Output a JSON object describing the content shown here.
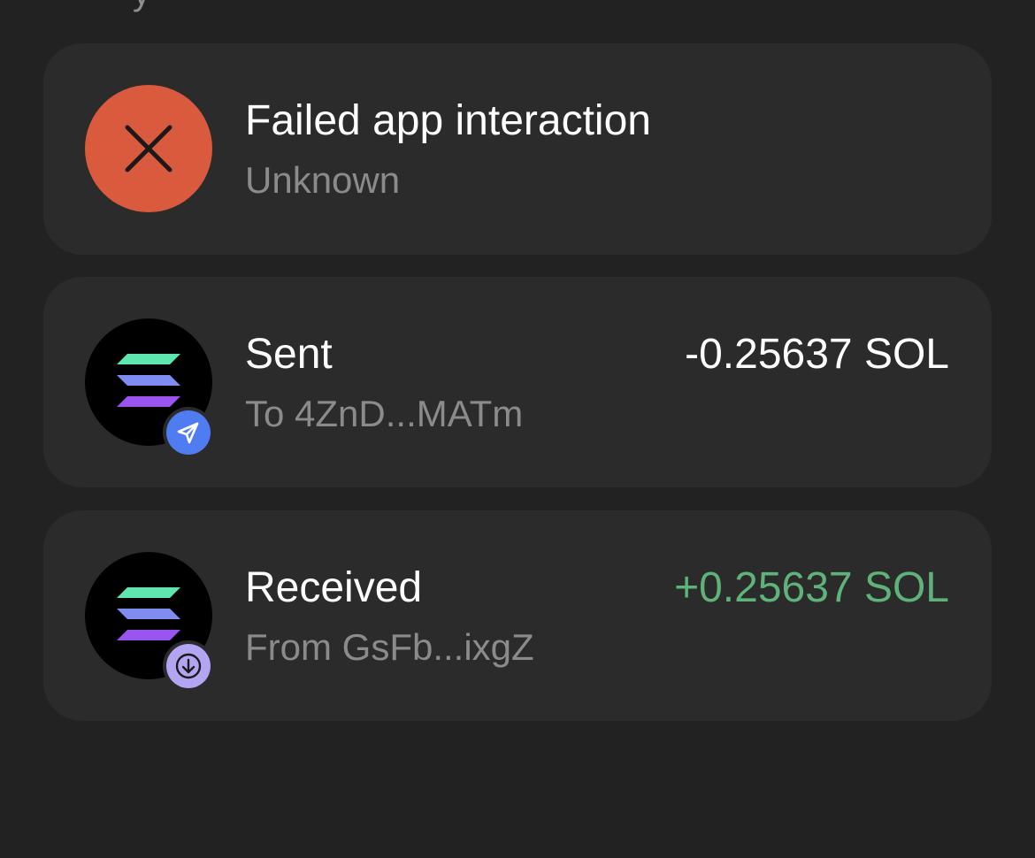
{
  "transactions": [
    {
      "title": "Failed app interaction",
      "subtitle": "Unknown",
      "amount": "",
      "icon": "close-icon",
      "icon_bg": "#d95a3c"
    },
    {
      "title": "Sent",
      "subtitle": "To 4ZnD...MATm",
      "amount": "-0.25637 SOL",
      "amount_color": "#ffffff",
      "icon": "solana-logo-icon",
      "badge_icon": "paper-plane-icon",
      "badge_color": "#4f7cf0"
    },
    {
      "title": "Received",
      "subtitle": "From GsFb...ixgZ",
      "amount": "+0.25637 SOL",
      "amount_color": "#5fb27a",
      "icon": "solana-logo-icon",
      "badge_icon": "arrow-down-icon",
      "badge_color": "#b3a5f2"
    }
  ],
  "colors": {
    "background": "#222222",
    "card": "#2b2b2b",
    "primary_text": "#ffffff",
    "secondary_text": "#8b8b8b"
  }
}
